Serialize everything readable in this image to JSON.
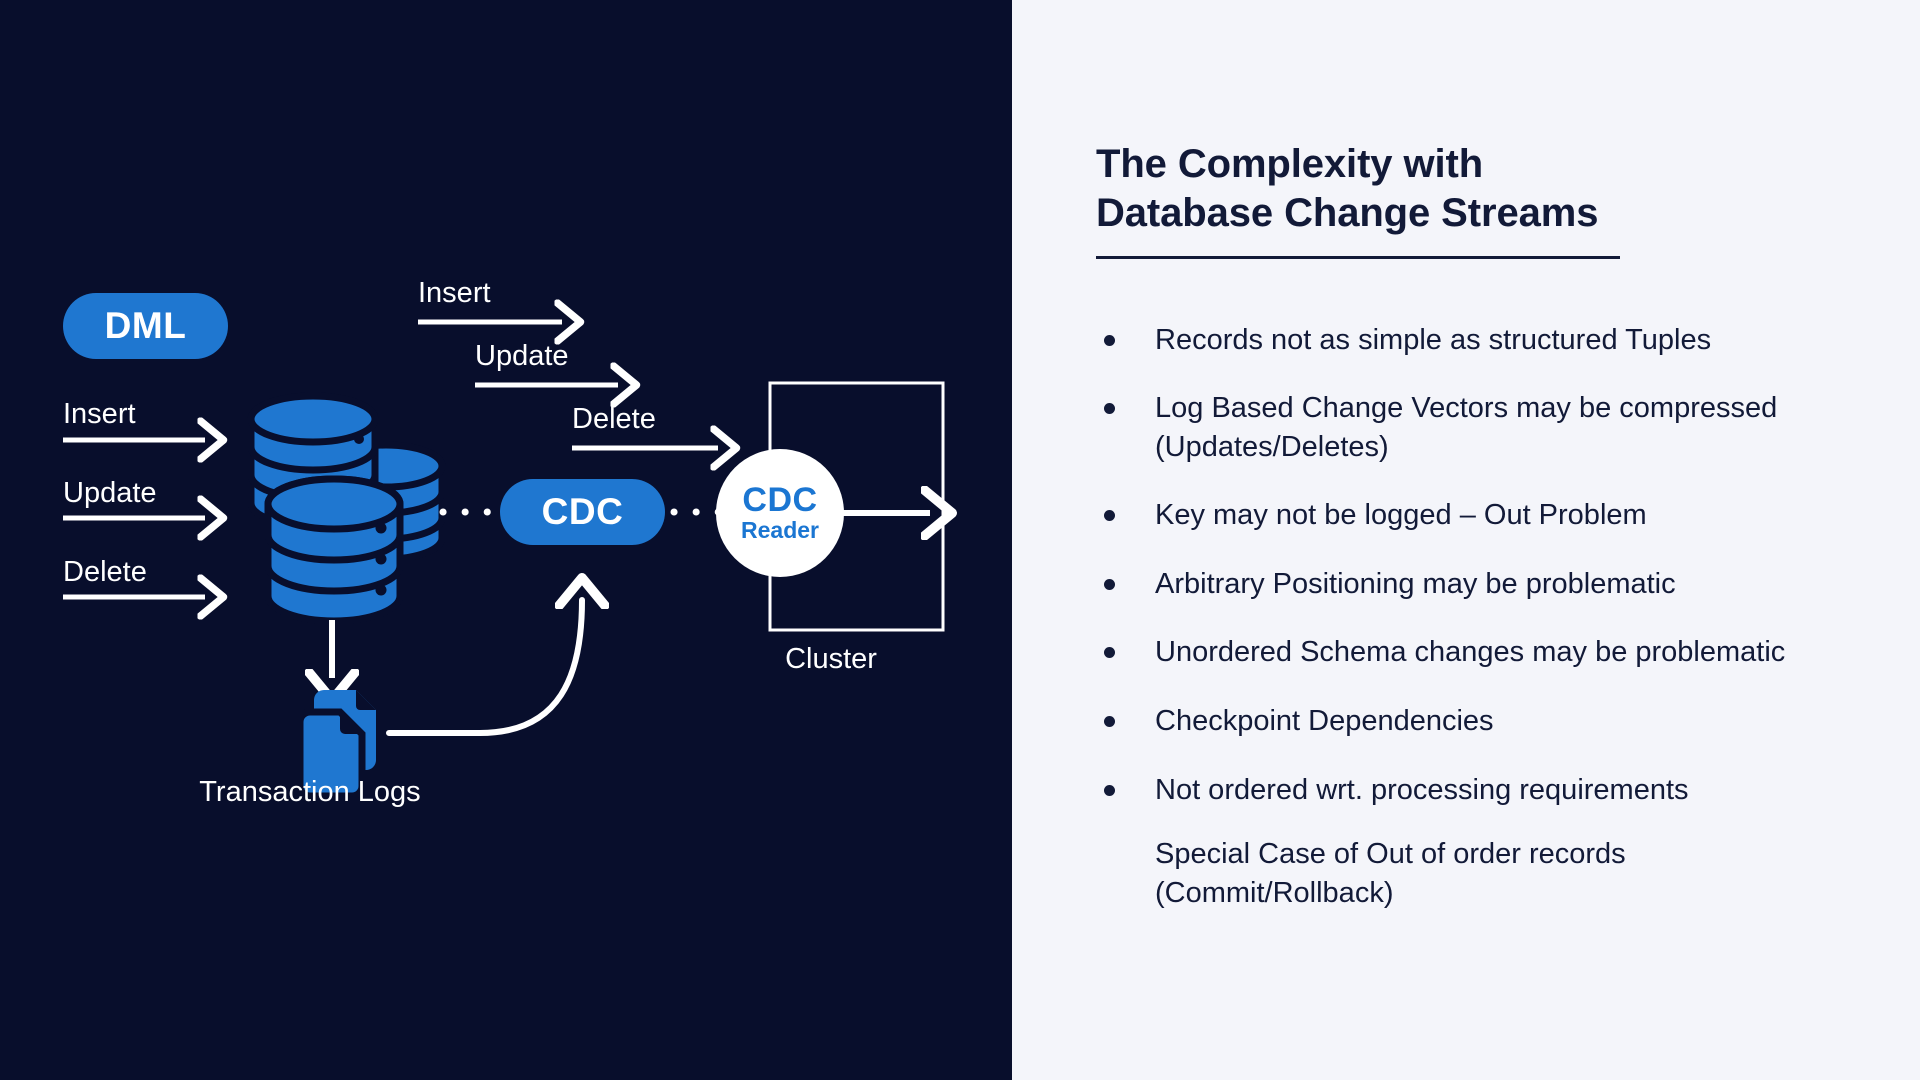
{
  "colors": {
    "diagram_background": "#080e2c",
    "content_background": "#f4f5fa",
    "accent_blue": "#1f77d0",
    "reader_blue": "#1b76d2",
    "ink": "#121a38",
    "stroke_white": "#ffffff"
  },
  "diagram": {
    "source_node": {
      "label": "DML",
      "type": "pill"
    },
    "source_operations": [
      {
        "label": "Insert"
      },
      {
        "label": "Update"
      },
      {
        "label": "Delete"
      }
    ],
    "database_icon": "database-stack-icon",
    "stream_operations": [
      {
        "label": "Insert"
      },
      {
        "label": "Update"
      },
      {
        "label": "Delete"
      }
    ],
    "cdc_node": {
      "label": "CDC",
      "type": "pill"
    },
    "cdc_reader": {
      "line1": "CDC",
      "line2": "Reader",
      "type": "circle"
    },
    "cluster": {
      "label": "Cluster",
      "type": "box"
    },
    "transaction_logs": {
      "label": "Transaction\nLogs",
      "icon": "documents-icon"
    }
  },
  "content": {
    "title": "The Complexity with\nDatabase Change Streams",
    "bullets": [
      {
        "text": "Records not as simple as structured Tuples",
        "bulleted": true
      },
      {
        "text": "Log Based Change Vectors may be compressed\n(Updates/Deletes)",
        "bulleted": true
      },
      {
        "text": "Key may not be logged – Out Problem",
        "bulleted": true
      },
      {
        "text": "Arbitrary Positioning may be problematic",
        "bulleted": true
      },
      {
        "text": "Unordered Schema changes may be problematic",
        "bulleted": true
      },
      {
        "text": "Checkpoint Dependencies",
        "bulleted": true
      },
      {
        "text": "Not ordered wrt. processing requirements",
        "bulleted": true
      },
      {
        "text": "Special Case of Out of order records\n(Commit/Rollback)",
        "bulleted": false
      }
    ]
  }
}
